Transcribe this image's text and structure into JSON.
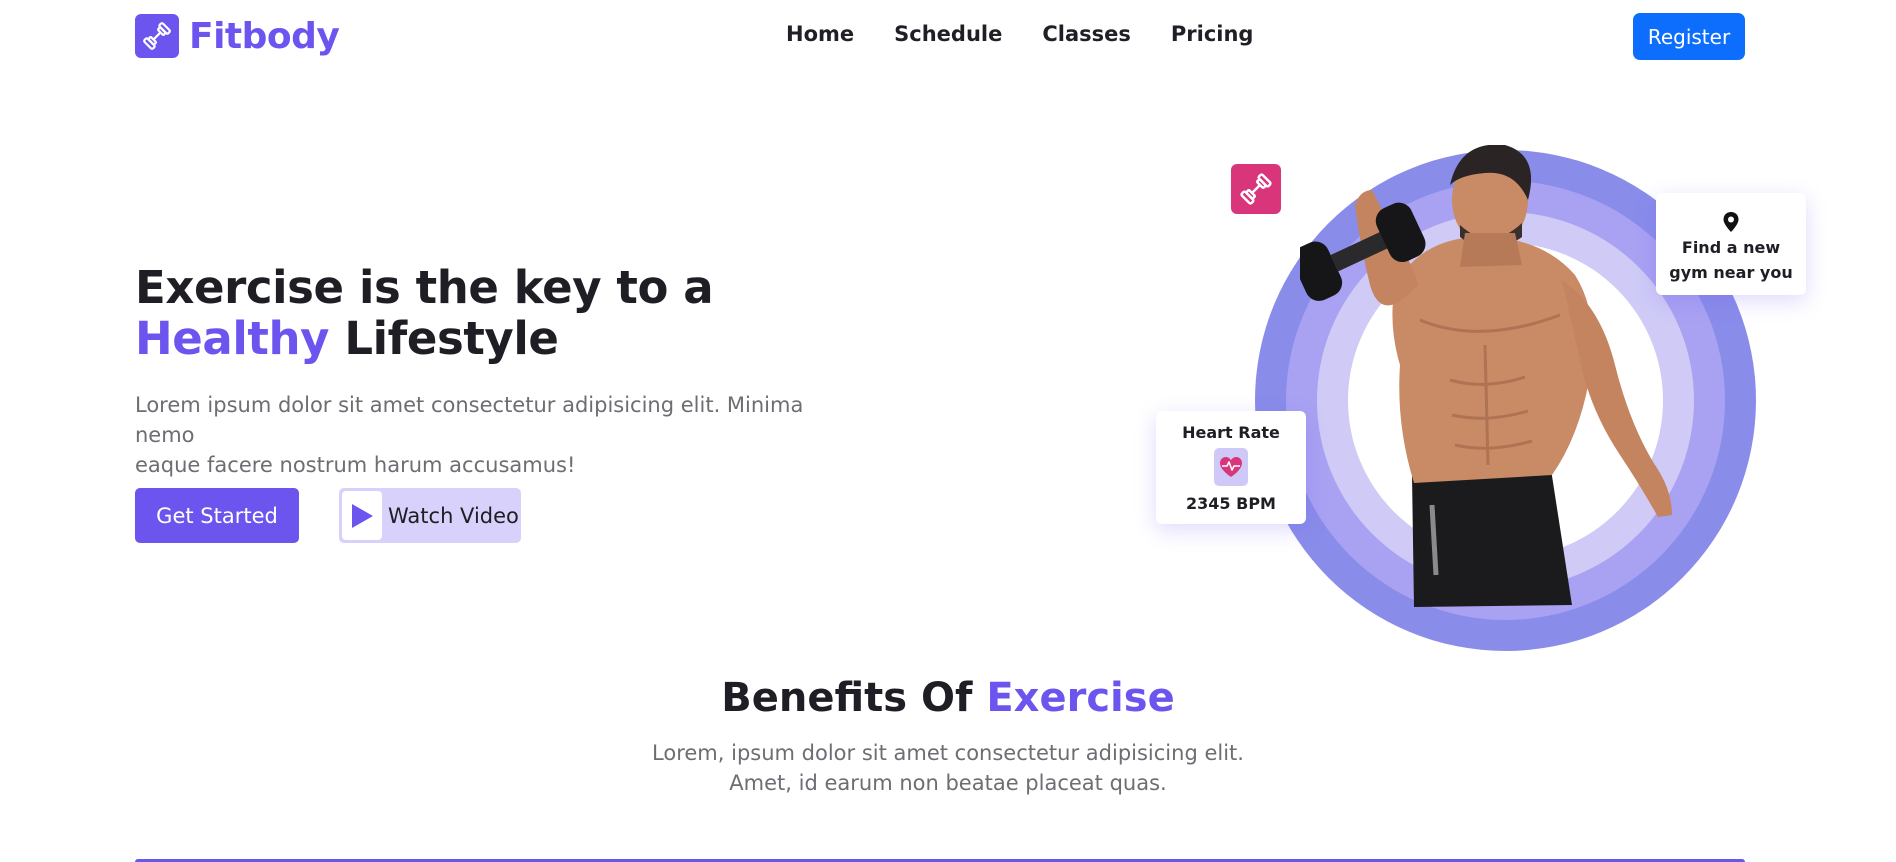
{
  "nav": {
    "logo_text": "Fitbody",
    "links": [
      "Home",
      "Schedule",
      "Classes",
      "Pricing"
    ],
    "register_label": "Register"
  },
  "hero": {
    "title_line1": "Exercise is the key to a",
    "title_accent": "Healthy",
    "title_rest": "Lifestyle",
    "subtitle_line1": "Lorem ipsum dolor sit amet consectetur adipisicing elit. Minima nemo",
    "subtitle_line2": "eaque facere nostrum harum accusamus!",
    "get_started_label": "Get Started",
    "watch_video_label": "Watch Video"
  },
  "cards": {
    "gym_line1": "Find a new",
    "gym_line2": "gym near you",
    "heart_title": "Heart Rate",
    "heart_value": "2345 BPM"
  },
  "benefits": {
    "title_main": "Benefits Of",
    "title_accent": "Exercise",
    "sub_line1": "Lorem, ipsum dolor sit amet consectetur adipisicing elit.",
    "sub_line2": "Amet, id earum non beatae placeat quas."
  },
  "colors": {
    "brand": "#6c55ef",
    "register": "#0d6efd",
    "pink": "#d8357b",
    "ring_outer": "#8a8cea",
    "ring_mid": "#a9a2f2",
    "ring_inner": "#cfcbf6"
  },
  "icons": {
    "logo": "dumbbell-icon",
    "play": "play-icon",
    "badge": "dumbbell-icon",
    "location": "location-pin-icon",
    "heart": "heart-pulse-icon"
  }
}
